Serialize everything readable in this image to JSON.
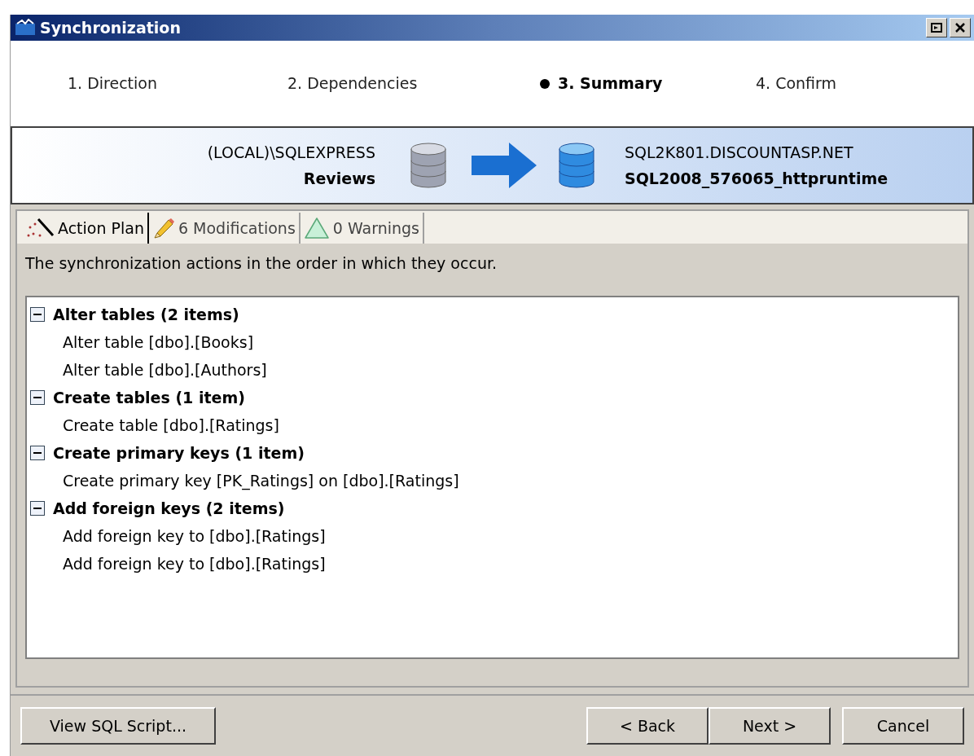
{
  "window": {
    "title": "Synchronization"
  },
  "steps": [
    {
      "label": "1. Direction",
      "selected": false
    },
    {
      "label": "2. Dependencies",
      "selected": false
    },
    {
      "label": "3. Summary",
      "selected": true
    },
    {
      "label": "4. Confirm",
      "selected": false
    }
  ],
  "source": {
    "server": "(LOCAL)\\SQLEXPRESS",
    "database": "Reviews"
  },
  "target": {
    "server": "SQL2K801.DISCOUNTASP.NET",
    "database": "SQL2008_576065_httpruntime"
  },
  "tabs": [
    {
      "kind": "plan",
      "label": "Action Plan",
      "selected": true
    },
    {
      "kind": "modifications",
      "label": "6 Modifications",
      "selected": false
    },
    {
      "kind": "warnings",
      "label": "0 Warnings",
      "selected": false
    }
  ],
  "description": "The synchronization actions in the order in which they occur.",
  "actions": [
    {
      "label": "Alter tables (2 items)",
      "expanded": true,
      "children": [
        {
          "label": "Alter table [dbo].[Books]"
        },
        {
          "label": "Alter table [dbo].[Authors]"
        }
      ]
    },
    {
      "label": "Create tables (1 item)",
      "expanded": true,
      "children": [
        {
          "label": "Create table [dbo].[Ratings]"
        }
      ]
    },
    {
      "label": "Create primary keys (1 item)",
      "expanded": true,
      "children": [
        {
          "label": "Create primary key [PK_Ratings] on [dbo].[Ratings]"
        }
      ]
    },
    {
      "label": "Add foreign keys (2 items)",
      "expanded": true,
      "children": [
        {
          "label": "Add foreign key to [dbo].[Ratings]"
        },
        {
          "label": "Add foreign key to [dbo].[Ratings]"
        }
      ]
    }
  ],
  "buttons": {
    "view_script": "View SQL Script...",
    "back": "< Back",
    "next": "Next >",
    "cancel": "Cancel"
  }
}
